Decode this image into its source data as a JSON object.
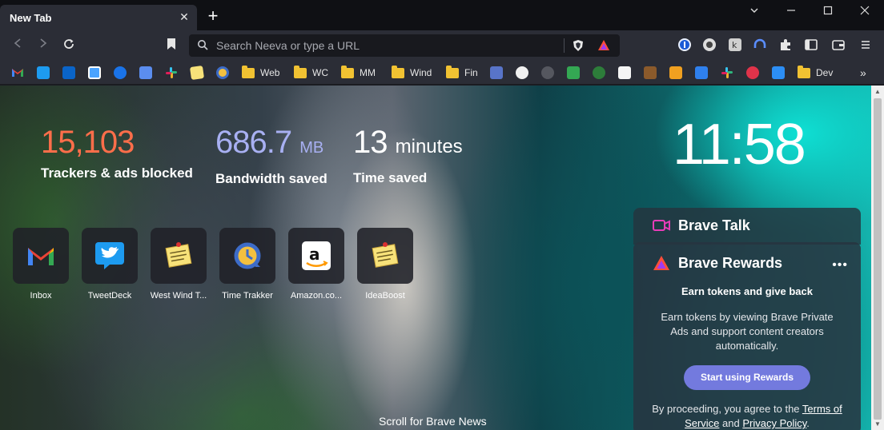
{
  "tab": {
    "title": "New Tab",
    "close": "✕",
    "new_tab": "+"
  },
  "window_controls": {
    "minimize": "—",
    "restore": "☐",
    "close": "✕",
    "menu": "⌄"
  },
  "toolbar": {
    "back": "◁",
    "forward": "▷",
    "reload": "↻",
    "menu": "≡"
  },
  "omnibox": {
    "placeholder": "Search Neeva or type a URL"
  },
  "bookmarks": {
    "items": [
      {
        "name": "gmail",
        "label": ""
      },
      {
        "name": "twitter",
        "label": ""
      },
      {
        "name": "outlook",
        "label": ""
      },
      {
        "name": "calendar",
        "label": ""
      },
      {
        "name": "contacts",
        "label": ""
      },
      {
        "name": "translate",
        "label": ""
      },
      {
        "name": "slack",
        "label": ""
      },
      {
        "name": "notes",
        "label": ""
      },
      {
        "name": "time-trakker",
        "label": ""
      },
      {
        "name": "folder-web",
        "label": "Web"
      },
      {
        "name": "folder-wc",
        "label": "WC"
      },
      {
        "name": "folder-mm",
        "label": "MM"
      },
      {
        "name": "folder-wind",
        "label": "Wind"
      },
      {
        "name": "folder-fin",
        "label": "Fin"
      },
      {
        "name": "folder-dev",
        "label": "Dev"
      }
    ],
    "overflow": "»"
  },
  "stats": {
    "trackers": {
      "value": "15,103",
      "label": "Trackers & ads blocked",
      "color": "#ff6e4a"
    },
    "bandwidth": {
      "value": "686.7",
      "unit": "MB",
      "label": "Bandwidth saved",
      "color": "#a8b0f2"
    },
    "time": {
      "value": "13",
      "unit": "minutes",
      "label": "Time saved",
      "color": "#ffffff"
    }
  },
  "clock": "11:58",
  "top_sites": [
    {
      "label": "Inbox",
      "icon": "gmail-icon"
    },
    {
      "label": "TweetDeck",
      "icon": "twitter-icon"
    },
    {
      "label": "West Wind T...",
      "icon": "notes-icon"
    },
    {
      "label": "Time Trakker",
      "icon": "time-trakker-icon"
    },
    {
      "label": "Amazon.co...",
      "icon": "amazon-icon"
    },
    {
      "label": "IdeaBoost",
      "icon": "notes-icon"
    }
  ],
  "scroll_news": "Scroll for Brave News",
  "brave_talk": {
    "title": "Brave Talk"
  },
  "brave_rewards": {
    "title": "Brave Rewards",
    "more": "•••",
    "subtitle": "Earn tokens and give back",
    "description": "Earn tokens by viewing Brave Private Ads and support content creators automatically.",
    "button": "Start using Rewards",
    "legal_prefix": "By proceeding, you agree to the ",
    "terms": "Terms of Service",
    "legal_and": " and ",
    "privacy": "Privacy Policy",
    "legal_suffix": "."
  },
  "colors": {
    "accent": "#737ade",
    "tab_bg": "#2b2d36",
    "titlebar": "#0f1014"
  }
}
